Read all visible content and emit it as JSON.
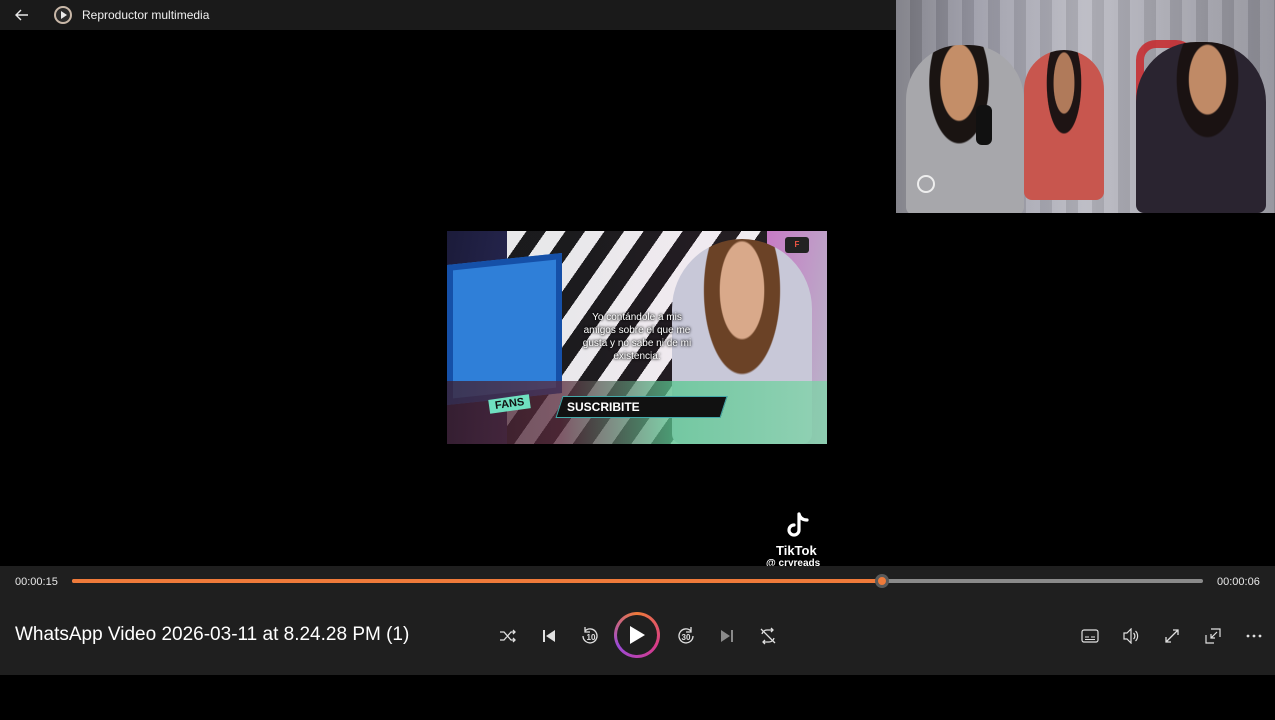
{
  "app": {
    "title": "Reproductor multimedia",
    "icons": {
      "back": "back-arrow-icon",
      "app": "media-player-icon"
    }
  },
  "video": {
    "title": "WhatsApp Video 2026-03-11 at 8.24.28 PM (1)",
    "elapsed": "00:00:15",
    "remaining": "00:00:06",
    "progress_fraction": 0.716
  },
  "clip": {
    "caption": "Yo contándole a mis amigos sobre el que me gusta y no sabe ni de mi existencia:",
    "subscribe_text": "SUSCRIBITE",
    "fans_text": "FANS",
    "logo_text": "F"
  },
  "watermark": {
    "brand": "TikTok",
    "handle": "@ cryreads"
  },
  "controls": {
    "shuffle": "shuffle-icon",
    "previous": "previous-icon",
    "rewind_seconds": "10",
    "play": "play-icon",
    "forward_seconds": "30",
    "next": "next-icon",
    "repeat": "repeat-off-icon",
    "subtitles": "subtitles-icon",
    "volume": "volume-icon",
    "fullscreen": "fullscreen-icon",
    "mini_player": "mini-player-icon",
    "more": "more-options-icon"
  },
  "colors": {
    "accent": "#ee7a3a",
    "play_gradient": [
      "#ee7a3a",
      "#d73a8a",
      "#9b4ad6"
    ],
    "controls_bg": "#1f1f1f",
    "titlebar_bg": "#1a1a1a"
  }
}
